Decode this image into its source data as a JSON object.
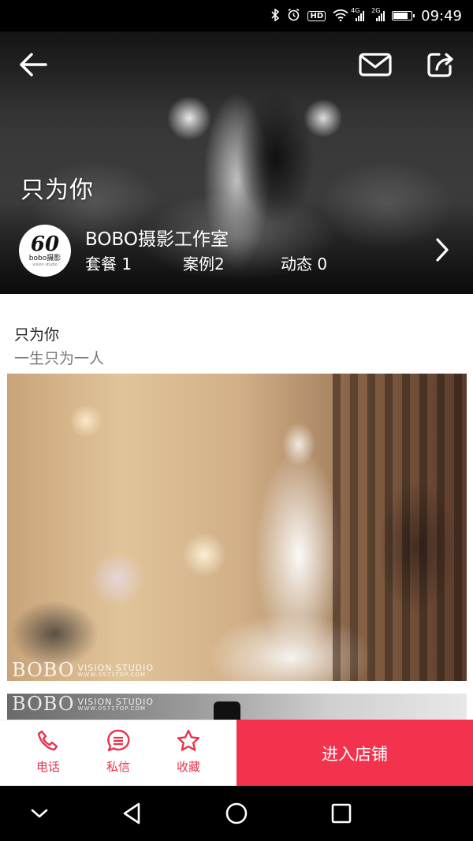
{
  "status_bar": {
    "hd_badge": "HD",
    "signal_1_label": "4G",
    "signal_2_label": "2G",
    "time": "09:49"
  },
  "hero": {
    "title": "只为你",
    "studio_name": "BOBO摄影工作室",
    "logo_mark": "60",
    "logo_text": "bobo摄影",
    "logo_tagline": "vision studio",
    "stats": {
      "packages": "套餐 1",
      "cases": "案例2",
      "updates": "动态 0"
    }
  },
  "section": {
    "title": "只为你",
    "subtitle": "一生只为一人"
  },
  "watermark": {
    "brand": "BOBO",
    "studio": "VISION STUDIO",
    "url": "WWW.0571TOP.COM"
  },
  "bottom_bar": {
    "phone_label": "电话",
    "message_label": "私信",
    "favorite_label": "收藏",
    "enter_store_label": "进入店铺"
  },
  "colors": {
    "accent": "#f3334d",
    "icon_red": "#e8334a"
  },
  "icons": {
    "back": "arrow-left-icon",
    "mail": "mail-icon",
    "share": "share-icon",
    "chevron": "chevron-right-icon",
    "phone": "phone-icon",
    "message": "chat-icon",
    "favorite": "star-icon"
  }
}
